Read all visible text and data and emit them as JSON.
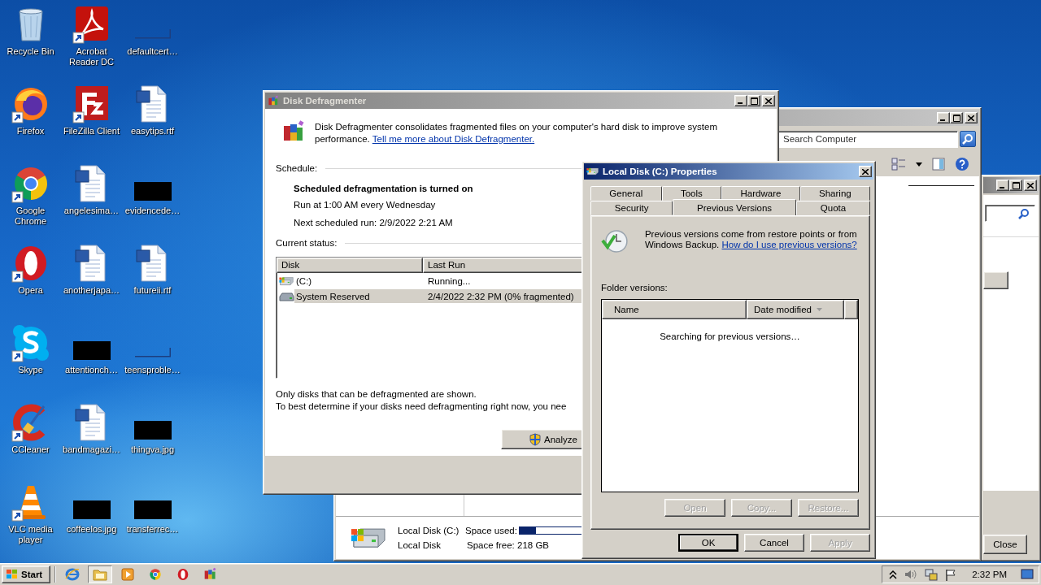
{
  "desktop_icons": [
    {
      "label": "Recycle Bin",
      "kind": "recycle",
      "shortcut": false
    },
    {
      "label": "Acrobat Reader DC",
      "kind": "acrobat",
      "shortcut": true
    },
    {
      "label": "defaultcert…",
      "kind": "blank",
      "shortcut": false
    },
    {
      "label": "Firefox",
      "kind": "firefox",
      "shortcut": true
    },
    {
      "label": "FileZilla Client",
      "kind": "filezilla",
      "shortcut": true
    },
    {
      "label": "easytips.rtf",
      "kind": "word",
      "shortcut": false
    },
    {
      "label": "Google Chrome",
      "kind": "chrome",
      "shortcut": true
    },
    {
      "label": "angelesima…",
      "kind": "word",
      "shortcut": false
    },
    {
      "label": "evidencede…",
      "kind": "black",
      "shortcut": false
    },
    {
      "label": "Opera",
      "kind": "opera",
      "shortcut": true
    },
    {
      "label": "anotherjapa…",
      "kind": "word",
      "shortcut": false
    },
    {
      "label": "futureii.rtf",
      "kind": "word",
      "shortcut": false
    },
    {
      "label": "Skype",
      "kind": "skype",
      "shortcut": true
    },
    {
      "label": "attentionch…",
      "kind": "black",
      "shortcut": false
    },
    {
      "label": "teensproble…",
      "kind": "blank",
      "shortcut": false
    },
    {
      "label": "CCleaner",
      "kind": "ccleaner",
      "shortcut": true
    },
    {
      "label": "bandmagazi…",
      "kind": "word",
      "shortcut": false
    },
    {
      "label": "thingva.jpg",
      "kind": "black",
      "shortcut": false
    },
    {
      "label": "VLC media player",
      "kind": "vlc",
      "shortcut": true
    },
    {
      "label": "coffeelos.jpg",
      "kind": "black",
      "shortcut": false
    },
    {
      "label": "transferrec…",
      "kind": "black",
      "shortcut": false
    }
  ],
  "back_window": {
    "active": false,
    "close_button": "Close"
  },
  "computer_window": {
    "active": false,
    "search": {
      "placeholder": "Search Computer"
    },
    "details": {
      "name": "Local Disk (C:)",
      "type": "Local Disk",
      "used_label": "Space used:",
      "level": 0.2,
      "free": "Space free: 218 GB"
    }
  },
  "defragmenter": {
    "title": "Disk Defragmenter",
    "active": false,
    "description": "Disk Defragmenter consolidates fragmented files on your computer's hard disk to improve system performance.",
    "learn_link": "Tell me more about Disk Defragmenter.",
    "schedule_label": "Schedule:",
    "schedule_status": "Scheduled defragmentation is turned on",
    "run_time": "Run at 1:00 AM every Wednesday",
    "next_run": "Next scheduled run: 2/9/2022 2:21 AM",
    "status_label": "Current status:",
    "columns": [
      "Disk",
      "Last Run"
    ],
    "disks": [
      {
        "kind": "system",
        "name": "(C:)",
        "last_run": "Running...",
        "selected": false
      },
      {
        "kind": "reserved",
        "name": "System Reserved",
        "last_run": "2/4/2022 2:32 PM (0% fragmented)",
        "selected": true
      }
    ],
    "notes": [
      "Only disks that can be defragmented are shown.",
      "To best determine if your disks need defragmenting right now, you nee"
    ],
    "analyze_button": "Analyze"
  },
  "properties_dialog": {
    "title": "Local Disk (C:) Properties",
    "active": true,
    "tab_rows": [
      {
        "tabs": [
          {
            "label": "General",
            "selected": false
          },
          {
            "label": "Tools",
            "selected": false
          },
          {
            "label": "Hardware",
            "selected": false
          },
          {
            "label": "Sharing",
            "selected": false
          }
        ]
      },
      {
        "tabs": [
          {
            "label": "Security",
            "selected": false
          },
          {
            "label": "Previous Versions",
            "selected": true
          },
          {
            "label": "Quota",
            "selected": false
          }
        ]
      }
    ],
    "intro": "Previous versions come from restore points or from Windows Backup.",
    "help_link": "How do I use previous versions?",
    "folder_label": "Folder versions:",
    "columns": [
      {
        "label": "Name",
        "sorted": false
      },
      {
        "label": "Date modified",
        "sorted": true
      }
    ],
    "status": "Searching for previous versions…",
    "action_buttons": [
      {
        "label": "Open",
        "disabled": true
      },
      {
        "label": "Copy...",
        "disabled": true
      },
      {
        "label": "Restore...",
        "disabled": true
      }
    ],
    "dialog_buttons": [
      {
        "label": "OK",
        "disabled": false,
        "default": true
      },
      {
        "label": "Cancel",
        "disabled": false,
        "default": false
      },
      {
        "label": "Apply",
        "disabled": true,
        "default": false
      }
    ]
  },
  "taskbar": {
    "start": "Start",
    "apps": [
      {
        "kind": "ie",
        "selected": false
      },
      {
        "kind": "explorer",
        "selected": true
      },
      {
        "kind": "media",
        "selected": false
      },
      {
        "kind": "chrome",
        "selected": false
      },
      {
        "kind": "opera",
        "selected": false
      },
      {
        "kind": "defrag",
        "selected": false
      }
    ],
    "clock": "2:32 PM"
  }
}
